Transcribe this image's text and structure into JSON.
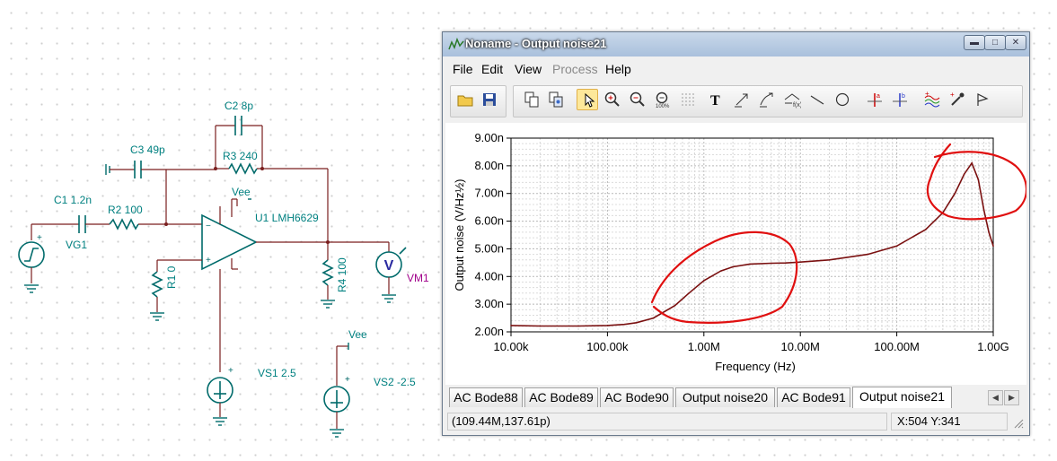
{
  "schematic": {
    "labels": {
      "c2": "C2 8p",
      "c3": "C3 49p",
      "r3": "R3 240",
      "vee_top": "Vee",
      "c1": "C1 1.2n",
      "r2": "R2 100",
      "u1": "U1 LMH6629",
      "vg1": "VG1",
      "r1": "R1 0",
      "r4": "R4 100",
      "vm1": "VM1",
      "vm_symbol": "V",
      "vee_bottom": "Vee",
      "vs1": "VS1 2.5",
      "vs2": "VS2 -2.5"
    }
  },
  "window": {
    "title": "Noname - Output noise21",
    "menu": [
      "File",
      "Edit",
      "View",
      "Process",
      "Help"
    ],
    "menu_disabled": "Process",
    "toolbar_icons": [
      "open-folder-icon",
      "save-icon",
      "copy-icon",
      "copy-page-icon",
      "pointer-icon",
      "zoom-in-icon",
      "zoom-out-icon",
      "zoom-100-icon",
      "grid-icon",
      "text-icon",
      "arrow-text-icon",
      "curve-text-icon",
      "formula-icon",
      "line-icon",
      "circle-icon",
      "cursor-a-icon",
      "cursor-b-icon",
      "curves-icon",
      "dropper-icon",
      "flag-icon"
    ]
  },
  "chart_data": {
    "type": "line",
    "xlabel": "Frequency (Hz)",
    "ylabel": "Output noise (V/Hz½)",
    "xscale": "log",
    "xlim": [
      10000,
      1000000000
    ],
    "ylim": [
      2e-09,
      9e-09
    ],
    "x_tick_labels": [
      "10.00k",
      "100.00k",
      "1.00M",
      "10.00M",
      "100.00M",
      "1.00G"
    ],
    "y_tick_labels": [
      "2.00n",
      "3.00n",
      "4.00n",
      "5.00n",
      "6.00n",
      "7.00n",
      "8.00n",
      "9.00n"
    ],
    "grid": true,
    "series": [
      {
        "color": "#7a1010",
        "x": [
          10000,
          20000,
          50000,
          100000,
          150000,
          200000,
          300000,
          500000,
          700000,
          1000000,
          1500000,
          2000000,
          3000000,
          5000000,
          7000000,
          10000000,
          20000000,
          50000000,
          100000000,
          200000000,
          300000000,
          400000000,
          500000000,
          600000000,
          700000000,
          800000000,
          900000000,
          1000000000
        ],
        "y": [
          2.23e-09,
          2.21e-09,
          2.21e-09,
          2.23e-09,
          2.27e-09,
          2.33e-09,
          2.5e-09,
          2.95e-09,
          3.4e-09,
          3.85e-09,
          4.2e-09,
          4.35e-09,
          4.45e-09,
          4.48e-09,
          4.49e-09,
          4.52e-09,
          4.6e-09,
          4.8e-09,
          5.1e-09,
          5.7e-09,
          6.3e-09,
          7e-09,
          7.7e-09,
          8.1e-09,
          7.5e-09,
          6.4e-09,
          5.6e-09,
          5.1e-09
        ]
      }
    ],
    "annotations": "hand-drawn red outlines"
  },
  "tabs": {
    "items": [
      "AC Bode88",
      "AC Bode89",
      "AC Bode90",
      "Output noise20",
      "AC Bode91",
      "Output noise21"
    ],
    "active": "Output noise21"
  },
  "status": {
    "coords": "(109.44M,137.61p)",
    "cursor": "X:504  Y:341"
  }
}
